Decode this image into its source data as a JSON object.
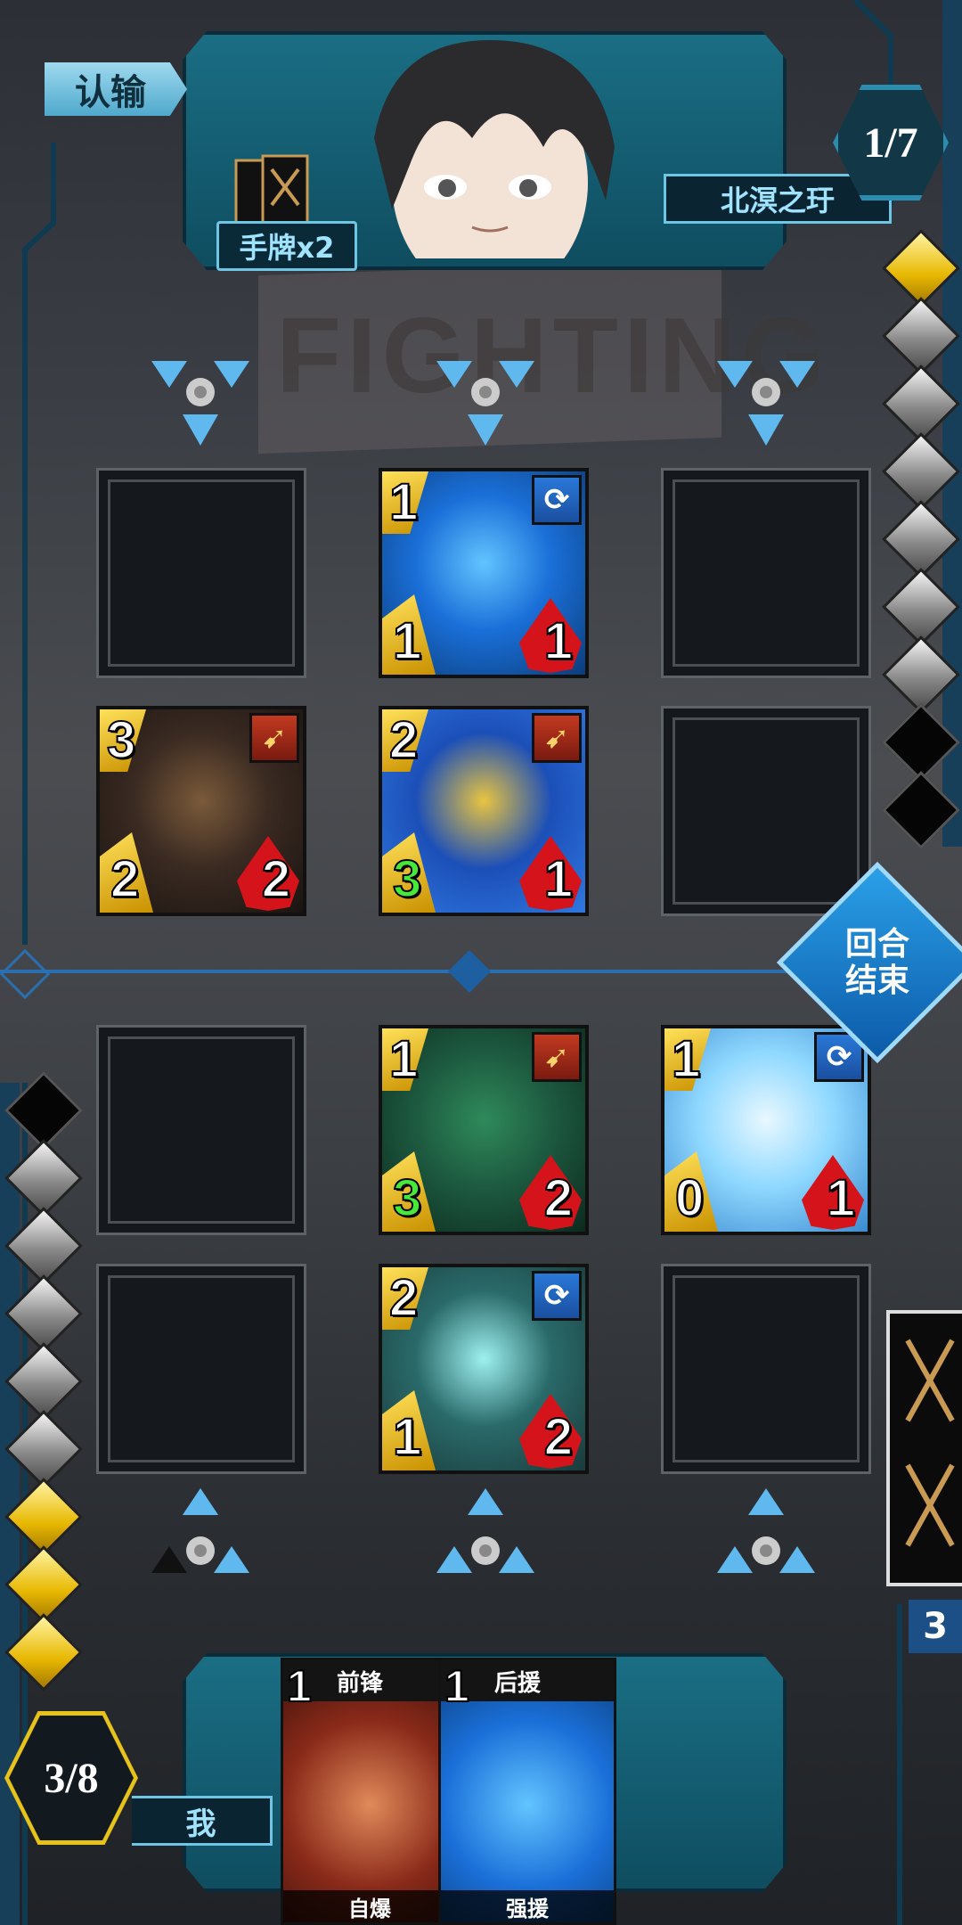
{
  "opponent": {
    "surrender_label": "认输",
    "hand_label": "手牌x2",
    "name": "北溟之玗",
    "turn_counter": "1/7"
  },
  "background_sign": "FIGHTING",
  "energy": {
    "opponent": [
      "gold",
      "silver",
      "silver",
      "silver",
      "silver",
      "silver",
      "silver",
      "black",
      "black"
    ],
    "player": [
      "black",
      "silver",
      "silver",
      "silver",
      "silver",
      "silver",
      "gold",
      "gold",
      "gold"
    ]
  },
  "board": {
    "opponent_back_row": [
      null,
      {
        "cost": "1",
        "atk": "1",
        "hp": "1",
        "type": "swap",
        "type_icon": "swap-icon",
        "art": "blue-dragon-robot",
        "atk_color": "#ffffff"
      },
      null
    ],
    "opponent_front_row": [
      {
        "cost": "3",
        "atk": "2",
        "hp": "2",
        "type": "attack",
        "type_icon": "arrow-attack-icon",
        "art": "dark-dragon",
        "atk_color": "#ffffff"
      },
      {
        "cost": "2",
        "atk": "3",
        "hp": "1",
        "type": "attack",
        "type_icon": "arrow-attack-icon",
        "art": "blue-armored-beast",
        "atk_color": "#46e83a"
      },
      null
    ],
    "player_front_row": [
      null,
      {
        "cost": "1",
        "atk": "3",
        "hp": "2",
        "type": "attack",
        "type_icon": "arrow-attack-icon",
        "art": "green-dragon",
        "atk_color": "#46e83a"
      },
      {
        "cost": "1",
        "atk": "0",
        "hp": "1",
        "type": "swap",
        "type_icon": "swap-icon",
        "art": "ice-egg",
        "atk_color": "#ffffff"
      }
    ],
    "player_back_row": [
      null,
      {
        "cost": "2",
        "atk": "1",
        "hp": "2",
        "type": "swap",
        "type_icon": "swap-icon",
        "art": "shield-bird",
        "atk_color": "#ffffff"
      },
      null
    ]
  },
  "end_turn": {
    "line1": "回合",
    "line2": "结束"
  },
  "deck_count": "3",
  "player": {
    "name": "我",
    "counter": "3/8",
    "hand": [
      {
        "cost": "1",
        "role": "前锋",
        "skill": "自爆",
        "art": "pig-monster"
      },
      {
        "cost": "1",
        "role": "后援",
        "skill": "强援",
        "art": "blue-dragon-robot"
      }
    ]
  },
  "colors": {
    "gold": "#e7c21a",
    "panel": "#1a6e84",
    "accent": "#6ec6e4",
    "hp_red": "#d4141a",
    "green_stat": "#46e83a"
  }
}
